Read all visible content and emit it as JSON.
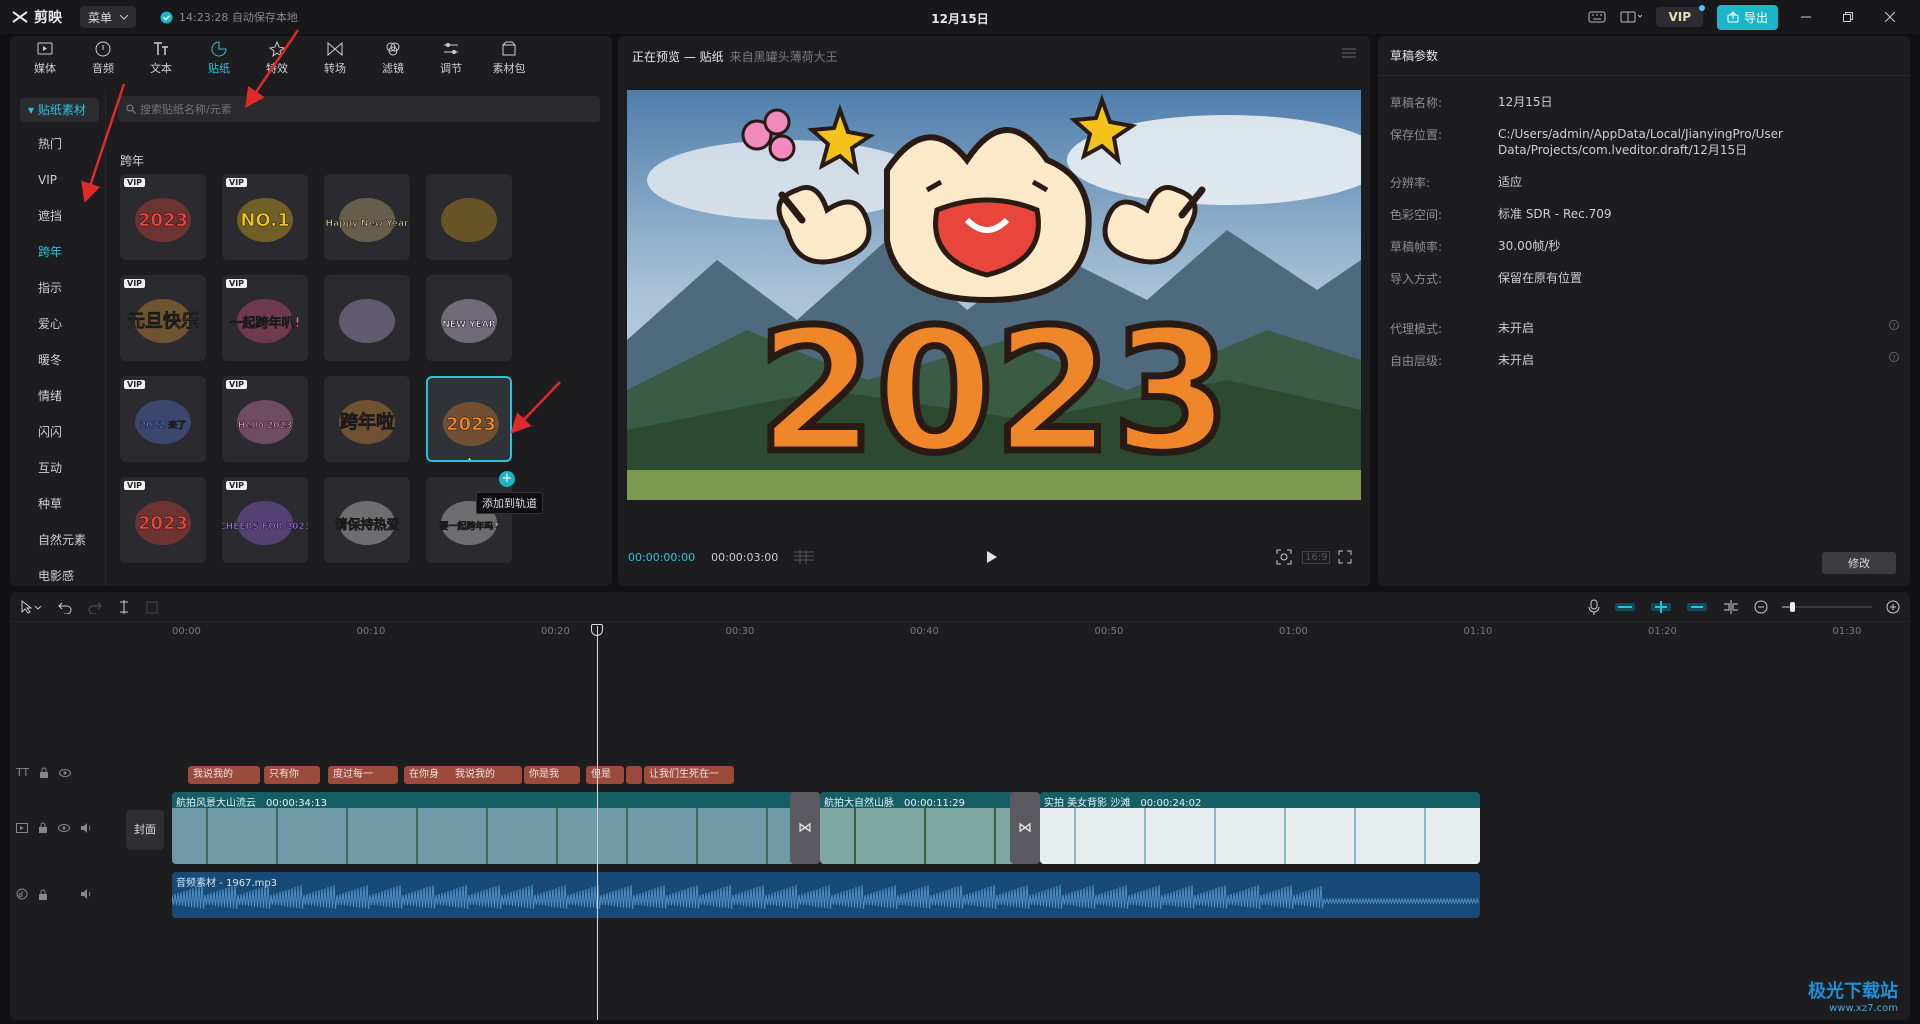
{
  "titlebar": {
    "app_name": "剪映",
    "menu_label": "菜单",
    "autosave": "14:23:28 自动保存本地",
    "title": "12月15日",
    "vip": "VIP",
    "export": "导出"
  },
  "media": {
    "tabs": [
      {
        "label": "媒体",
        "icon": "media-icon"
      },
      {
        "label": "音频",
        "icon": "audio-icon"
      },
      {
        "label": "文本",
        "icon": "text-icon"
      },
      {
        "label": "贴纸",
        "icon": "sticker-icon"
      },
      {
        "label": "特效",
        "icon": "effects-icon"
      },
      {
        "label": "转场",
        "icon": "transition-icon"
      },
      {
        "label": "滤镜",
        "icon": "filter-icon"
      },
      {
        "label": "调节",
        "icon": "adjust-icon"
      },
      {
        "label": "素材包",
        "icon": "package-icon"
      }
    ],
    "active_tab": "贴纸",
    "sidebar_header": "贴纸素材",
    "sidebar": [
      "热门",
      "VIP",
      "遮挡",
      "跨年",
      "指示",
      "爱心",
      "暖冬",
      "情绪",
      "闪闪",
      "互动",
      "种草",
      "自然元素",
      "电影感"
    ],
    "active_sidebar": "跨年",
    "search_placeholder": "搜索贴纸名称/元素",
    "section_title": "跨年",
    "tooltip": "添加到轨道",
    "stickers": [
      {
        "vip": true,
        "text": "2023",
        "color": "#e8463a"
      },
      {
        "vip": true,
        "text": "NO.1",
        "color": "#f3c31b"
      },
      {
        "vip": false,
        "text": "Happy New Year",
        "color": "#d9c28a"
      },
      {
        "vip": false,
        "text": "",
        "color": "#e0a21a"
      },
      {
        "vip": true,
        "text": "元旦快乐",
        "color": "#f2a33a"
      },
      {
        "vip": true,
        "text": "一起跨年叭!",
        "color": "#f05a8a"
      },
      {
        "vip": false,
        "text": "",
        "color": "#c9b6e8"
      },
      {
        "vip": false,
        "text": "NEW YEAR",
        "color": "#f0e6ff"
      },
      {
        "vip": true,
        "text": "2022 来了",
        "color": "#5b7fe8"
      },
      {
        "vip": true,
        "text": "Hello 2023",
        "color": "#f28bbd"
      },
      {
        "vip": false,
        "text": "跨年啦",
        "color": "#f39a3a"
      },
      {
        "vip": false,
        "text": "2023",
        "color": "#f0862a"
      },
      {
        "vip": true,
        "text": "2023",
        "color": "#e8463a"
      },
      {
        "vip": true,
        "text": "CHEERS FOR 2023",
        "color": "#a36cf0"
      },
      {
        "vip": false,
        "text": "请保持热爱",
        "color": "#eeeeee"
      },
      {
        "vip": false,
        "text": "要一起跨年吗?",
        "color": "#eeeeee"
      }
    ]
  },
  "preview": {
    "title": "正在预览 — 贴纸",
    "source": "来自黑罐头薄荷大王",
    "time_current": "00:00:00:00",
    "time_total": "00:00:03:00",
    "ratio": "16:9",
    "sticker_text": "2023"
  },
  "props": {
    "header": "草稿参数",
    "rows": [
      {
        "label": "草稿名称:",
        "value": "12月15日"
      },
      {
        "label": "保存位置:",
        "value": "C:/Users/admin/AppData/Local/JianyingPro/User Data/Projects/com.lveditor.draft/12月15日"
      },
      {
        "label": "分辨率:",
        "value": "适应"
      },
      {
        "label": "色彩空间:",
        "value": "标准 SDR - Rec.709"
      },
      {
        "label": "草稿帧率:",
        "value": "30.00帧/秒"
      },
      {
        "label": "导入方式:",
        "value": "保留在原有位置"
      },
      {
        "label": "代理模式:",
        "value": "未开启"
      },
      {
        "label": "自由层级:",
        "value": "未开启"
      }
    ],
    "modify": "修改"
  },
  "timeline": {
    "ticks": [
      "00:00",
      "00:10",
      "00:20",
      "00:30",
      "00:40",
      "00:50",
      "01:00",
      "01:10",
      "01:20",
      "01:30"
    ],
    "text_clips": [
      "我说我的",
      "只有你",
      "度过每一",
      "在你身",
      "我说我的",
      "你是我",
      "但是",
      "",
      "让我们生死在一"
    ],
    "cover": "封面",
    "video_clips": [
      {
        "name": "航拍风景大山流云",
        "duration": "00:00:34:13"
      },
      {
        "name": "航拍大自然山脉",
        "duration": "00:00:11:29"
      },
      {
        "name": "实拍 美女背影 沙滩",
        "duration": "00:00:24:02"
      }
    ],
    "audio_clip": "音频素材 - 1967.mp3"
  },
  "watermark": {
    "name": "极光下载站",
    "url": "www.xz7.com"
  },
  "colors": {
    "accent": "#29c4dc",
    "export": "#1bb5c8",
    "text_clip": "#9b4a3c",
    "video_clip": "#155e66",
    "audio_clip": "#174a77"
  }
}
